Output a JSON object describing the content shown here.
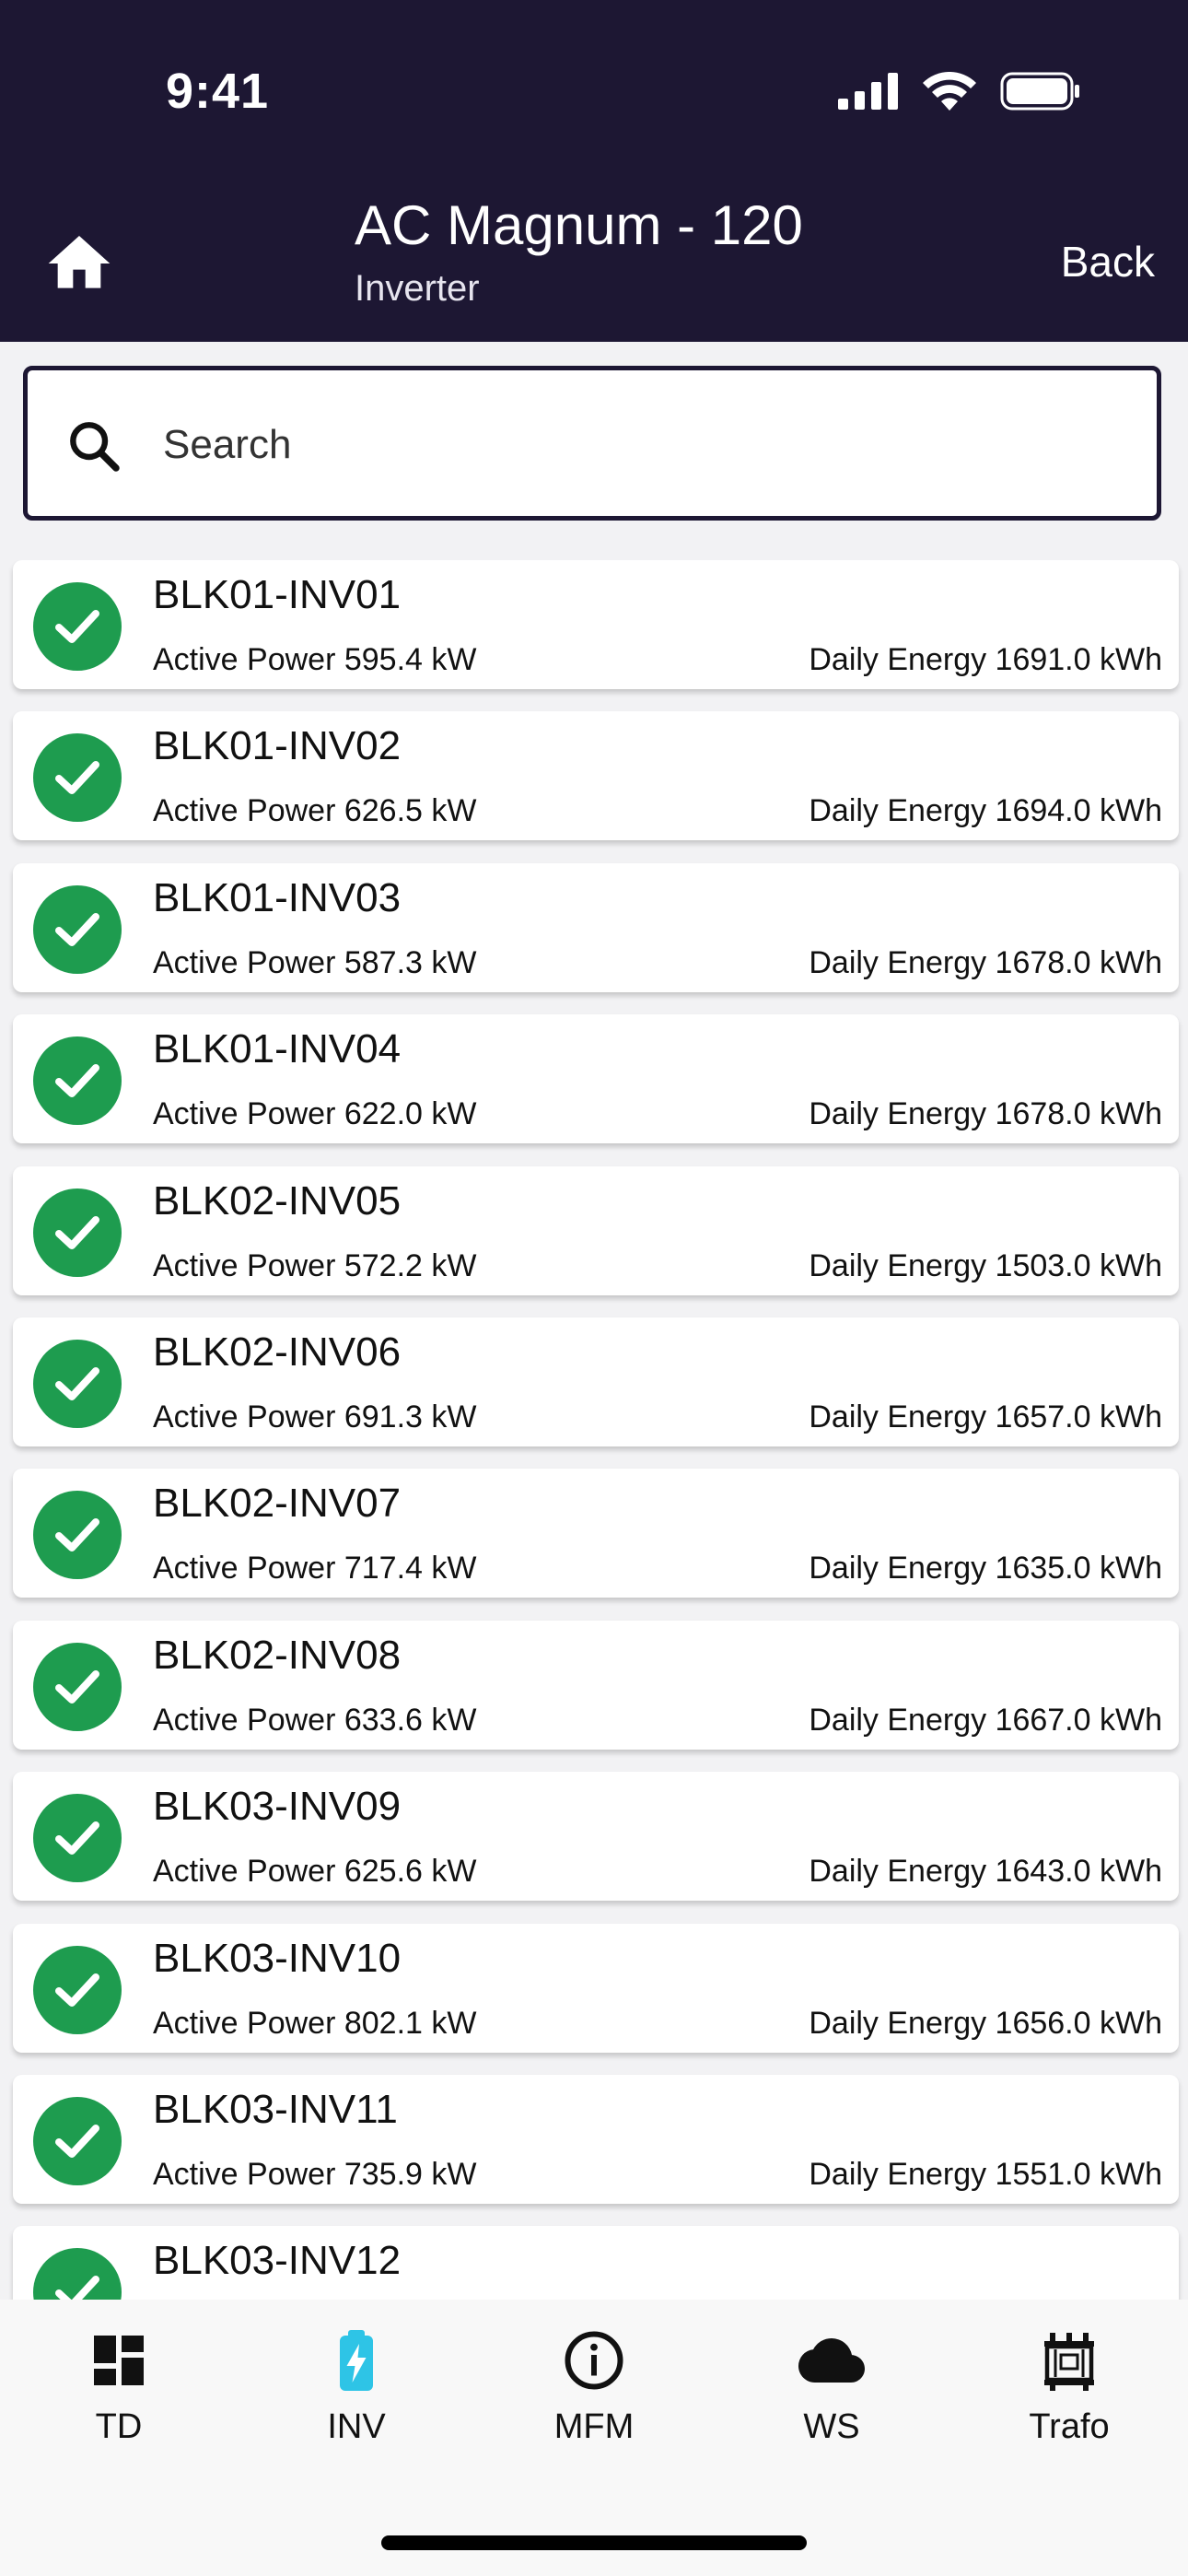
{
  "status_bar": {
    "time": "9:41",
    "icons": [
      "signal-icon",
      "wifi-icon",
      "battery-icon"
    ]
  },
  "header": {
    "title": "AC Magnum - 120",
    "subtitle": "Inverter",
    "back_label": "Back",
    "home_icon": "home-icon"
  },
  "search": {
    "placeholder": "Search",
    "value": ""
  },
  "inverters": [
    {
      "name": "BLK01-INV01",
      "power": "Active Power 595.4 kW",
      "energy": "Daily Energy 1691.0 kWh"
    },
    {
      "name": "BLK01-INV02",
      "power": "Active Power 626.5 kW",
      "energy": "Daily Energy 1694.0 kWh"
    },
    {
      "name": "BLK01-INV03",
      "power": "Active Power 587.3 kW",
      "energy": "Daily Energy 1678.0 kWh"
    },
    {
      "name": "BLK01-INV04",
      "power": "Active Power 622.0 kW",
      "energy": "Daily Energy 1678.0 kWh"
    },
    {
      "name": "BLK02-INV05",
      "power": "Active Power 572.2 kW",
      "energy": "Daily Energy 1503.0 kWh"
    },
    {
      "name": "BLK02-INV06",
      "power": "Active Power 691.3 kW",
      "energy": "Daily Energy 1657.0 kWh"
    },
    {
      "name": "BLK02-INV07",
      "power": "Active Power 717.4 kW",
      "energy": "Daily Energy 1635.0 kWh"
    },
    {
      "name": "BLK02-INV08",
      "power": "Active Power 633.6 kW",
      "energy": "Daily Energy 1667.0 kWh"
    },
    {
      "name": "BLK03-INV09",
      "power": "Active Power 625.6 kW",
      "energy": "Daily Energy 1643.0 kWh"
    },
    {
      "name": "BLK03-INV10",
      "power": "Active Power 802.1 kW",
      "energy": "Daily Energy 1656.0 kWh"
    },
    {
      "name": "BLK03-INV11",
      "power": "Active Power 735.9 kW",
      "energy": "Daily Energy 1551.0 kWh"
    },
    {
      "name": "BLK03-INV12",
      "power": "",
      "energy": ""
    }
  ],
  "tabs": [
    {
      "label": "TD",
      "icon": "dashboard-icon",
      "active": false
    },
    {
      "label": "INV",
      "icon": "battery-charging-icon",
      "active": true
    },
    {
      "label": "MFM",
      "icon": "info-icon",
      "active": false
    },
    {
      "label": "WS",
      "icon": "cloud-icon",
      "active": false
    },
    {
      "label": "Trafo",
      "icon": "transformer-icon",
      "active": false
    }
  ],
  "colors": {
    "header_bg": "#1d1733",
    "status_ok": "#1e9c4f",
    "active_tab": "#2ec4e6"
  }
}
